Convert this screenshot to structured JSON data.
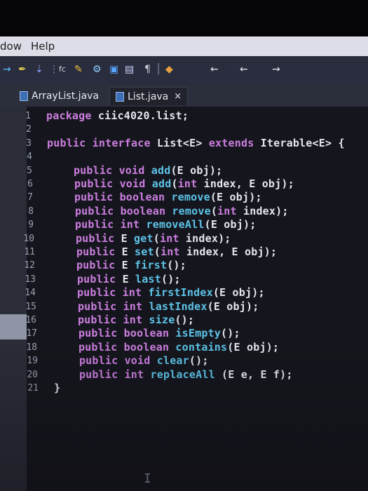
{
  "menubar": {
    "items": [
      "dow",
      "Help"
    ]
  },
  "toolbar": {
    "icons": [
      "run-icon",
      "paint-icon",
      "arrow-icon",
      "separator-icon",
      "format-icon",
      "brush-icon",
      "settings-icon",
      "window-icon",
      "layout-icon",
      "paragraph-icon",
      "cursor-icon",
      "nav-icon",
      "back-icon",
      "back2-icon",
      "forward-icon"
    ],
    "glyphs": [
      "→",
      "✒",
      "⇣",
      "⋮",
      "fc",
      "✎",
      "⚙",
      "▣",
      "▤",
      "¶",
      "│",
      "◆",
      "←",
      "←",
      "→"
    ]
  },
  "tabs": [
    {
      "label": "ArrayList.java",
      "active": false
    },
    {
      "label": "List.java",
      "active": true,
      "close": "×"
    }
  ],
  "editor": {
    "line_numbers": [
      "1",
      "2",
      "3",
      "4",
      "5",
      "6",
      "7",
      "8",
      "9",
      "10",
      "11",
      "12",
      "13",
      "14",
      "15",
      "16",
      "17",
      "18",
      "19",
      "20",
      "21"
    ],
    "lines": [
      "package ciic4020.list;",
      "",
      "public interface List<E> extends Iterable<E> {",
      "",
      "    public void add(E obj);",
      "    public void add(int index, E obj);",
      "    public boolean remove(E obj);",
      "    public boolean remove(int index);",
      "    public int removeAll(E obj);",
      "    public E get(int index);",
      "    public E set(int index, E obj);",
      "    public E first();",
      "    public E last();",
      "    public int firstIndex(E obj);",
      "    public int lastIndex(E obj);",
      "    public int size();",
      "    public boolean isEmpty();",
      "    public boolean contains(E obj);",
      "    public void clear();",
      "    public int replaceAll (E e, E f);",
      "}"
    ],
    "cursor": "I"
  },
  "colors": {
    "keyword": "#cc7ee0",
    "method": "#5dc3e8",
    "text": "#e4e6ee",
    "background": "#15161d"
  }
}
